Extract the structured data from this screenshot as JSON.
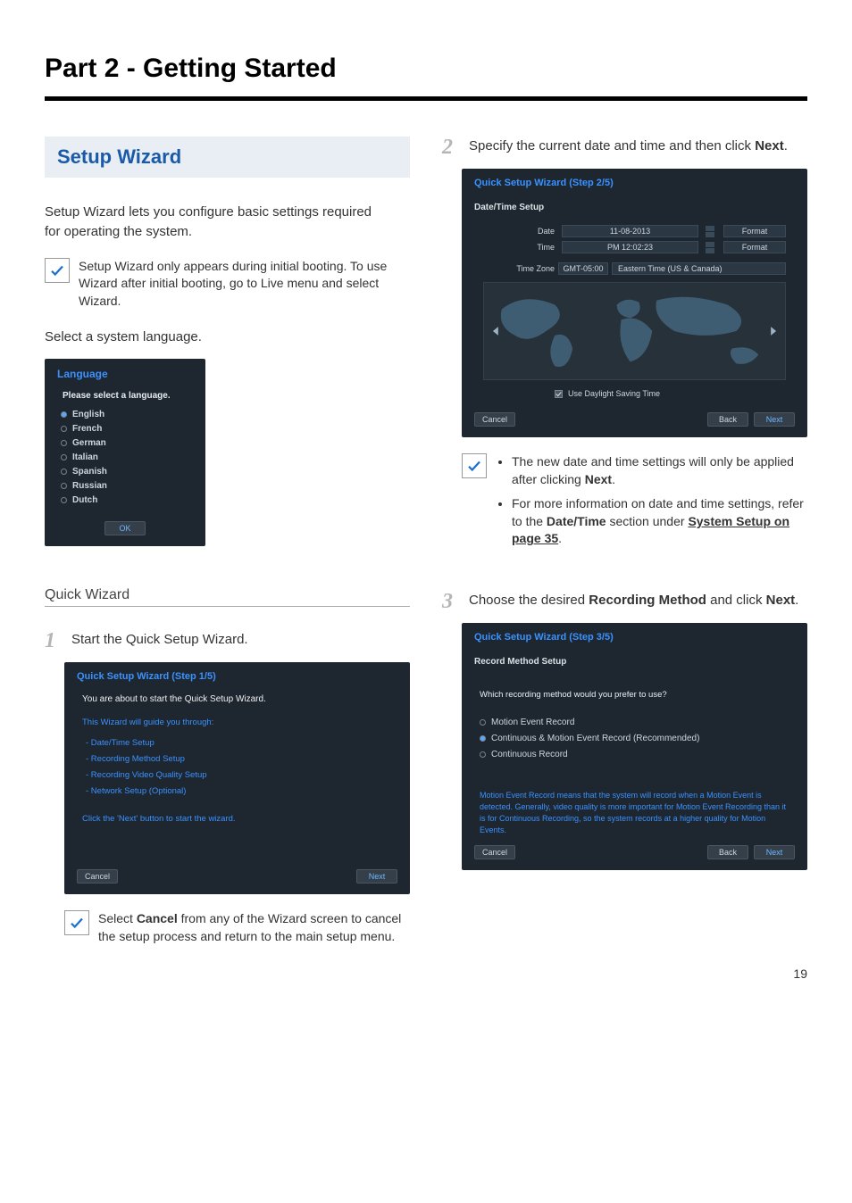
{
  "page": {
    "title": "Part 2 - Getting Started",
    "number": "19"
  },
  "left": {
    "sectionHeading": "Setup Wizard",
    "intro": "Setup Wizard lets you configure basic settings required for operating the system.",
    "note1": "Setup Wizard only appears during initial booting. To use Wizard after initial booting, go to Live menu and select Wizard.",
    "selectLang": "Select a system language.",
    "langDialog": {
      "title": "Language",
      "prompt": "Please select a language.",
      "items": [
        "English",
        "French",
        "German",
        "Italian",
        "Spanish",
        "Russian",
        "Dutch"
      ],
      "ok": "OK"
    },
    "quickWizardHeading": "Quick Wizard",
    "step1num": "1",
    "step1text": "Start the Quick Setup Wizard.",
    "wiz1": {
      "title": "Quick Setup Wizard (Step 1/5)",
      "line1": "You are about to start the Quick Setup Wizard.",
      "line2": "This Wizard will guide you through:",
      "items": [
        "- Date/Time Setup",
        "- Recording Method Setup",
        "- Recording Video Quality Setup",
        "- Network Setup (Optional)"
      ],
      "line3": "Click the 'Next' button to start the wizard.",
      "cancel": "Cancel",
      "next": "Next"
    },
    "note2_a": "Select ",
    "note2_bold": "Cancel",
    "note2_b": " from any of the Wizard screen to cancel the setup process and return to the main setup menu."
  },
  "right": {
    "step2num": "2",
    "step2text_a": "Specify the current date and time and then click ",
    "step2text_bold": "Next",
    "step2text_b": ".",
    "wiz2": {
      "title": "Quick Setup Wizard (Step 2/5)",
      "section": "Date/Time Setup",
      "dateLabel": "Date",
      "dateVal": "11-08-2013",
      "formatLabel": "Format",
      "timeLabel": "Time",
      "timeVal": "PM 12:02:23",
      "tzLabel": "Time Zone",
      "tzVal1": "GMT-05:00",
      "tzVal2": "Eastern Time (US & Canada)",
      "dst": "Use Daylight Saving Time",
      "cancel": "Cancel",
      "back": "Back",
      "next": "Next"
    },
    "note3": {
      "li1_a": "The new date and time settings will only be applied after clicking ",
      "li1_bold": "Next",
      "li1_b": ".",
      "li2_a": "For more information on date and time settings, refer to the ",
      "li2_bold": "Date/Time",
      "li2_b": " section under ",
      "li2_link": "System Setup on page 35",
      "li2_c": "."
    },
    "step3num": "3",
    "step3text_a": "Choose the desired ",
    "step3text_bold": "Recording Method",
    "step3text_b": " and click ",
    "step3text_bold2": "Next",
    "step3text_c": ".",
    "wiz3": {
      "title": "Quick Setup Wizard (Step 3/5)",
      "section": "Record Method Setup",
      "question": "Which recording method would you prefer to use?",
      "opts": [
        "Motion Event Record",
        "Continuous & Motion Event Record (Recommended)",
        "Continuous Record"
      ],
      "explain": "Motion Event Record means that the system will record when a Motion Event is detected. Generally, video quality is more important for Motion Event Recording than it is for Continuous Recording, so the system records at a higher quality for Motion Events.",
      "cancel": "Cancel",
      "back": "Back",
      "next": "Next"
    }
  }
}
